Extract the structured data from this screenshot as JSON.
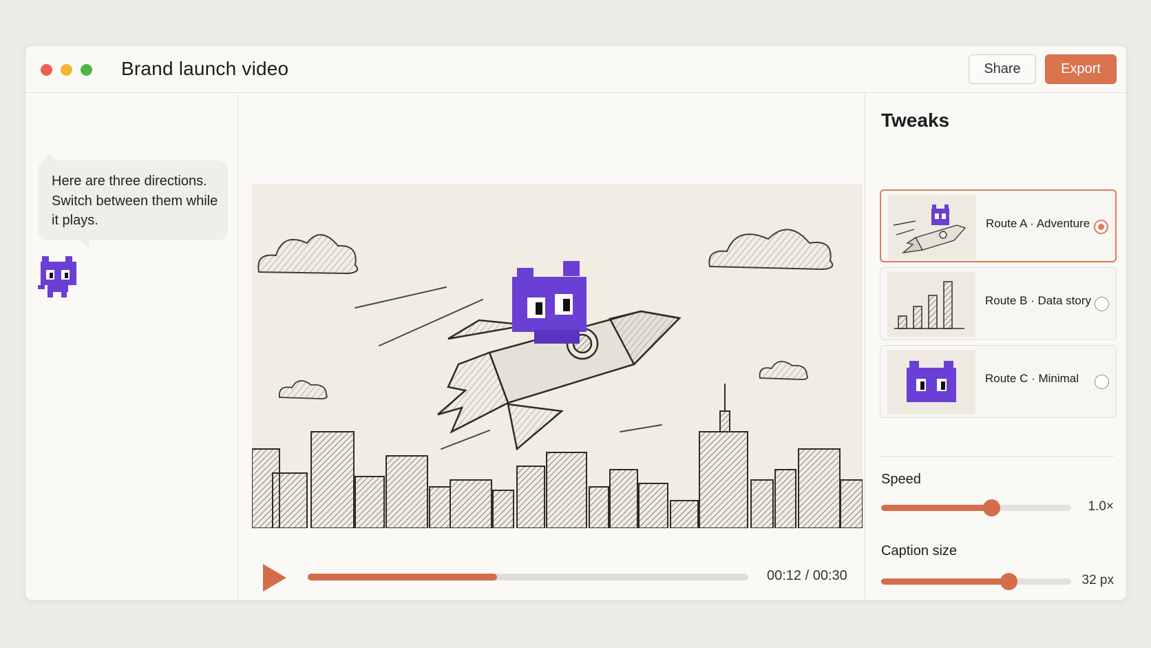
{
  "window": {
    "title": "Brand launch video",
    "share_label": "Share",
    "export_label": "Export",
    "accent_color": "#d9744f"
  },
  "assistant": {
    "message": "Here are three directions. Switch between them while it plays.",
    "avatar_icon": "pixel-cat-icon",
    "avatar_color": "#6a3fd4"
  },
  "player": {
    "current_time": "00:12",
    "total_time": "00:30",
    "timecode": "00:12 / 00:30",
    "progress": 0.43,
    "play_icon": "play-icon"
  },
  "tweaks": {
    "title": "Tweaks",
    "routes": [
      {
        "label": "Route A · Adventure",
        "selected": true,
        "thumb_icon": "rocket-cat-thumbnail"
      },
      {
        "label": "Route B · Data story",
        "selected": false,
        "thumb_icon": "bar-chart-thumbnail"
      },
      {
        "label": "Route C · Minimal",
        "selected": false,
        "thumb_icon": "cat-face-thumbnail"
      }
    ],
    "speed": {
      "label": "Speed",
      "value": "1.0×",
      "fraction": 0.58
    },
    "caption_size": {
      "label": "Caption size",
      "value": "32 px",
      "fraction": 0.67
    }
  }
}
